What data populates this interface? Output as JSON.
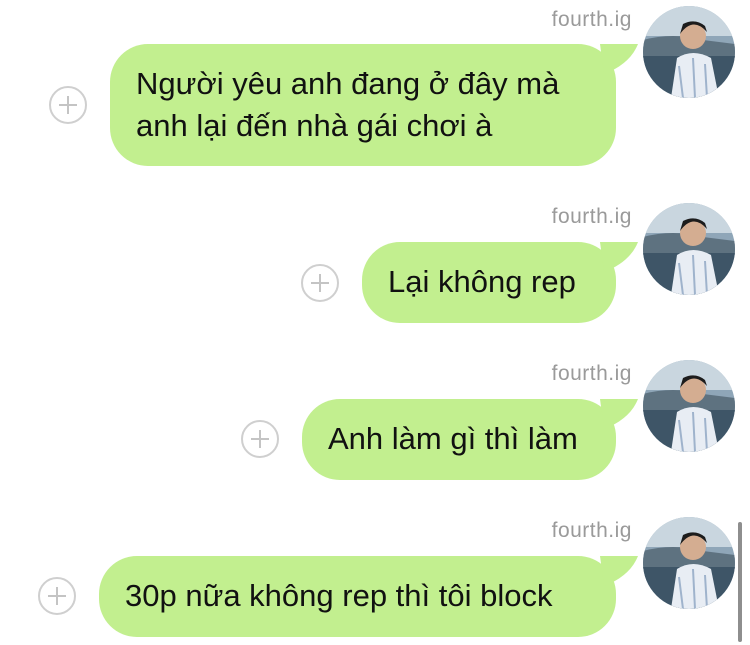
{
  "chat": {
    "accent_bubble_color": "#c2ef8f",
    "messages": [
      {
        "sender": "fourth.ig",
        "text": "Người yêu anh đang ở đây mà\nanh lại đến nhà gái chơi à"
      },
      {
        "sender": "fourth.ig",
        "text": "Lại không rep"
      },
      {
        "sender": "fourth.ig",
        "text": "Anh làm gì thì làm"
      },
      {
        "sender": "fourth.ig",
        "text": "30p nữa không rep thì tôi block"
      }
    ]
  },
  "icons": {
    "add": "plus-circle-icon",
    "avatar": "profile-photo"
  }
}
